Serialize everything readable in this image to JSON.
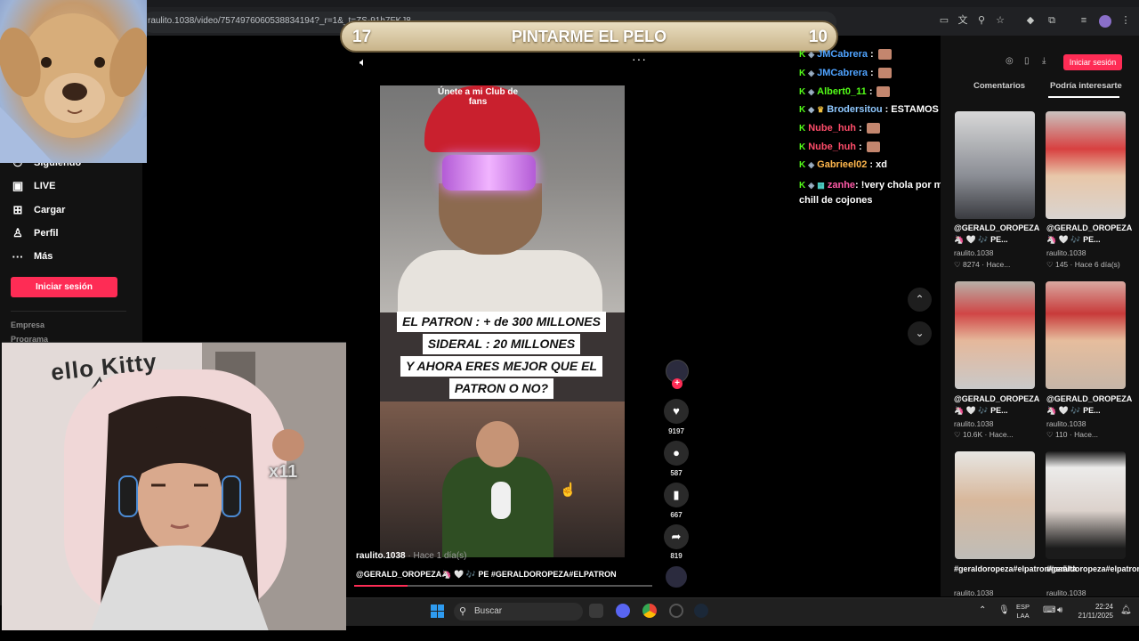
{
  "browser": {
    "url": "raulito.1038/video/7574976060538834194?_r=1&_t=ZS-91h7FKJ8"
  },
  "game_banner": {
    "left_number": "17",
    "title": "PINTARME EL PELO",
    "right_number": "10"
  },
  "sidebar": {
    "items": [
      {
        "label": "Siguiendo",
        "icon": "following-icon"
      },
      {
        "label": "LIVE",
        "icon": "live-icon"
      },
      {
        "label": "Cargar",
        "icon": "upload-icon"
      },
      {
        "label": "Perfil",
        "icon": "profile-icon"
      },
      {
        "label": "Más",
        "icon": "more-icon"
      }
    ],
    "login_label": "Iniciar sesión",
    "footer": [
      "Empresa",
      "Programa"
    ]
  },
  "streamer_cam": {
    "wall_text": "ello Kitty",
    "badge": "x11"
  },
  "video": {
    "cap_text": "Únete a mi Club de fans",
    "overlay_lines": [
      "EL PATRON : + de 300 MILLONES",
      "SIDERAL : 20 MILLONES",
      "Y AHORA ERES MEJOR QUE EL",
      "PATRON O NO?"
    ],
    "author": "raulito.1038",
    "author_time": "· Hace 1 día(s)",
    "caption": "@GERALD_OROPEZA🦄 🤍 🎶 PE #GERALDOROPEZA#ELPATRON",
    "progress": 0.18
  },
  "rail": {
    "likes": "9197",
    "comments": "587",
    "saves": "667",
    "shares": "819"
  },
  "chat": {
    "lines": [
      {
        "name": "JMCabrera",
        "msg": ":",
        "color": "#4fa3ff",
        "emote": true
      },
      {
        "name": "JMCabrera",
        "msg": ":",
        "color": "#4fa3ff",
        "emote": true
      },
      {
        "name": "Albert0_11",
        "msg": ":",
        "color": "#53fc18",
        "emote": true
      },
      {
        "name": "Brodersitou",
        "msg": ": ESTAMOS FULL TDA",
        "color": "#8fc8ff",
        "emote": true
      },
      {
        "name": "Nube_huh",
        "msg": ":",
        "color": "#ff4d6a",
        "emote": true
      },
      {
        "name": "Nube_huh",
        "msg": ":",
        "color": "#ff4d6a",
        "emote": true
      },
      {
        "name": "Gabrieel02",
        "msg": ": xd",
        "color": "#ffb74d",
        "emote": false
      }
    ],
    "long": {
      "name": "zanhe",
      "msg": ": !very chola por menos baneabas se nota que estas bien chill de cojones",
      "color": "#ff5aa8"
    }
  },
  "right_panel": {
    "login_label": "Iniciar sesión",
    "tabs": [
      "Comentarios",
      "Podría interesarte"
    ],
    "thumbs": [
      {
        "title": "@GERALD_OROPEZA🦄 🤍 🎶 PE...",
        "user": "raulito.1038",
        "stats": "♡ 8274 · Hace..."
      },
      {
        "title": "@GERALD_OROPEZA🦄 🤍 🎶 PE...",
        "user": "raulito.1038",
        "stats": "♡ 145 · Hace 6 día(s)"
      },
      {
        "title": "@GERALD_OROPEZA🦄 🤍 🎶 PE...",
        "user": "raulito.1038",
        "stats": "♡ 10.6K · Hace..."
      },
      {
        "title": "@GERALD_OROPEZA🦄 🤍 🎶 PE...",
        "user": "raulito.1038",
        "stats": "♡ 110 · Hace..."
      },
      {
        "title": "#geraldoropeza#elpatron#cañita",
        "user": "raulito.1038",
        "stats": ""
      },
      {
        "title": "#geraldoropeza#elpatron",
        "user": "raulito.1038",
        "stats": ""
      }
    ]
  },
  "taskbar": {
    "search_label": "Buscar",
    "lang_top": "ESP",
    "lang_bottom": "LAA",
    "time": "22:24",
    "date": "21/11/2025"
  },
  "colors": {
    "accent": "#fe2c55",
    "kick_green": "#53fc18"
  }
}
